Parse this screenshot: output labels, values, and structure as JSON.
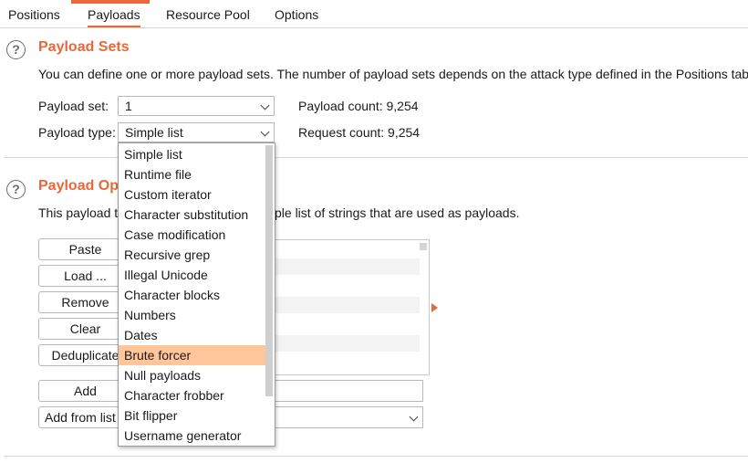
{
  "tabs": [
    "Positions",
    "Payloads",
    "Resource Pool",
    "Options"
  ],
  "payload_sets": {
    "title": "Payload Sets",
    "description": "You can define one or more payload sets. The number of payload sets depends on the attack type defined in the Positions tab.",
    "set_label": "Payload set:",
    "set_value": "1",
    "type_label": "Payload type:",
    "type_value": "Simple list",
    "payload_count": "Payload count: 9,254",
    "request_count": "Request count: 9,254"
  },
  "payload_options": {
    "title_visible": "Payload Op",
    "description_left": "This payload ty",
    "description_right": "ple list of strings that are used as payloads.",
    "buttons": [
      "Paste",
      "Load ...",
      "Remove",
      "Clear",
      "Deduplicate"
    ],
    "add_label": "Add",
    "add_from_list_label": "Add from list"
  },
  "payload_type_options": [
    "Simple list",
    "Runtime file",
    "Custom iterator",
    "Character substitution",
    "Case modification",
    "Recursive grep",
    "Illegal Unicode",
    "Character blocks",
    "Numbers",
    "Dates",
    "Brute forcer",
    "Null payloads",
    "Character frobber",
    "Bit flipper",
    "Username generator"
  ],
  "highlighted_option": "Brute forcer",
  "colors": {
    "accent": "#e8683a",
    "highlight": "#ffc59b"
  }
}
